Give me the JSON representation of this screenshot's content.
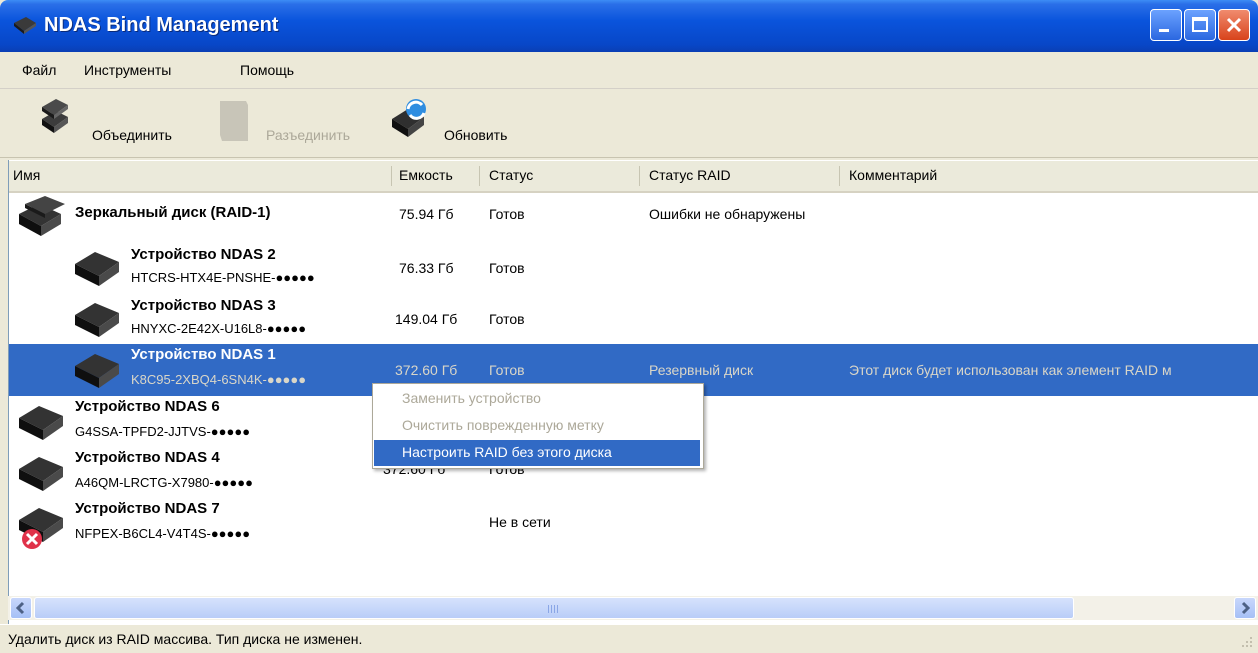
{
  "window": {
    "title": "NDAS Bind Management"
  },
  "menu": {
    "items": [
      "Файл",
      "Инструменты",
      "Помощь"
    ]
  },
  "toolbar": {
    "bind_label": "Объединить",
    "unbind_label": "Разъединить",
    "refresh_label": "Обновить"
  },
  "columns": {
    "name": "Имя",
    "capacity": "Емкость",
    "status": "Статус",
    "raid_status": "Статус RAID",
    "comment": "Комментарий"
  },
  "rows": [
    {
      "name": "Зеркальный диск (RAID-1)",
      "sub": "",
      "capacity": "75.94 Гб",
      "status": "Готов",
      "raid_status": "Ошибки не обнаружены",
      "comment": ""
    },
    {
      "name": "Устройство NDAS 2",
      "sub": "HTCRS-HTX4E-PNSHE-●●●●●",
      "capacity": "76.33 Гб",
      "status": "Готов",
      "raid_status": "",
      "comment": ""
    },
    {
      "name": "Устройство NDAS 3",
      "sub": "HNYXC-2E42X-U16L8-●●●●●",
      "capacity": "149.04 Гб",
      "status": "Готов",
      "raid_status": "",
      "comment": ""
    },
    {
      "name": "Устройство NDAS 1",
      "sub": "K8C95-2XBQ4-6SN4K-●●●●●",
      "capacity": "372.60 Гб",
      "status": "Готов",
      "raid_status": "Резервный диск",
      "comment": "Этот диск будет использован как элемент RAID м"
    },
    {
      "name": "Устройство NDAS 6",
      "sub": "G4SSA-TPFD2-JJTVS-●●●●●",
      "capacity": "",
      "status": "",
      "raid_status": "",
      "comment": ""
    },
    {
      "name": "Устройство NDAS 4",
      "sub": "A46QM-LRCTG-X7980-●●●●●",
      "capacity": "372.60 Гб",
      "status": "Готов",
      "raid_status": "",
      "comment": ""
    },
    {
      "name": "Устройство NDAS 7",
      "sub": "NFPEX-B6CL4-V4T4S-●●●●●",
      "capacity": "",
      "status": "Не в сети",
      "raid_status": "",
      "comment": ""
    }
  ],
  "context_menu": {
    "items": [
      "Заменить устройство",
      "Очистить поврежденную метку",
      "Настроить RAID без этого диска"
    ]
  },
  "status_bar": {
    "text": "Удалить диск из RAID массива. Тип диска не изменен."
  },
  "icons": {
    "title": "ndas-drive-icon",
    "bind": "bind-drives-icon",
    "unbind": "unbind-icon",
    "refresh": "refresh-icon",
    "offline": "error-x-icon"
  },
  "colors": {
    "selection": "#316ac5",
    "titlebar": "#0a54dc"
  }
}
